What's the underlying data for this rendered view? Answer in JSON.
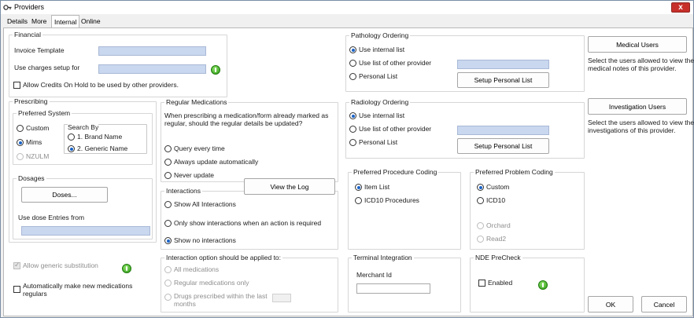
{
  "window": {
    "title": "Providers",
    "close_label": "x"
  },
  "tabs": [
    {
      "label": "Details"
    },
    {
      "label": "More"
    },
    {
      "label": "Internal"
    },
    {
      "label": "Online"
    }
  ],
  "financial": {
    "title": "Financial",
    "invoice_template_label": "Invoice Template",
    "invoice_template_value": "",
    "use_charges_label": "Use charges setup for",
    "use_charges_value": "",
    "allow_credits_label": "Allow Credits On Hold to be used by other providers."
  },
  "prescribing": {
    "title": "Prescribing",
    "preferred_system": {
      "title": "Preferred System",
      "options": [
        "Custom",
        "Mims",
        "NZULM"
      ],
      "selected": "Mims"
    },
    "search_by": {
      "title": "Search By",
      "options": [
        "1. Brand Name",
        "2. Generic Name"
      ],
      "selected": "2. Generic Name"
    },
    "dosages": {
      "title": "Dosages",
      "doses_button": "Doses...",
      "use_dose_label": "Use dose Entries from",
      "use_dose_value": ""
    },
    "allow_generic_label": "Allow generic substitution",
    "auto_regular_label": "Automatically make new medications regulars"
  },
  "regular_medications": {
    "title": "Regular Medications",
    "question": "When prescribing a medication/form already marked as regular, should the regular details be updated?",
    "options": [
      "Query every time",
      "Always update automatically",
      "Never update"
    ]
  },
  "interactions": {
    "title": "Interactions",
    "view_log_button": "View the Log",
    "options": [
      "Show All Interactions",
      "Only show interactions when an action is required",
      "Show no interactions"
    ],
    "selected": "Show no interactions"
  },
  "interaction_option": {
    "title": "Interaction option should be applied to:",
    "options": [
      "All medications",
      "Regular medications only",
      "Drugs prescribed within the last months"
    ]
  },
  "pathology": {
    "title": "Pathology Ordering",
    "options": [
      "Use internal list",
      "Use list of other provider",
      "Personal List"
    ],
    "selected": "Use internal list",
    "setup_button": "Setup Personal List"
  },
  "radiology": {
    "title": "Radiology Ordering",
    "options": [
      "Use internal list",
      "Use list of other provider",
      "Personal List"
    ],
    "selected": "Use internal list",
    "setup_button": "Setup Personal List"
  },
  "procedure_coding": {
    "title": "Preferred Procedure Coding",
    "options": [
      "Item List",
      "ICD10 Procedures"
    ],
    "selected": "Item List"
  },
  "problem_coding": {
    "title": "Preferred Problem Coding",
    "options": [
      "Custom",
      "ICD10",
      "Orchard",
      "Read2"
    ],
    "selected": "Custom"
  },
  "terminal": {
    "title": "Terminal Integration",
    "merchant_label": "Merchant Id",
    "merchant_value": ""
  },
  "nde": {
    "title": "NDE PreCheck",
    "enabled_label": "Enabled"
  },
  "side": {
    "medical_users_button": "Medical Users",
    "medical_users_text": "Select the users allowed to view the medical notes of this provider.",
    "investigation_users_button": "Investigation Users",
    "investigation_users_text": "Select the users allowed to view the investigations of this provider.",
    "ok_button": "OK",
    "cancel_button": "Cancel"
  }
}
